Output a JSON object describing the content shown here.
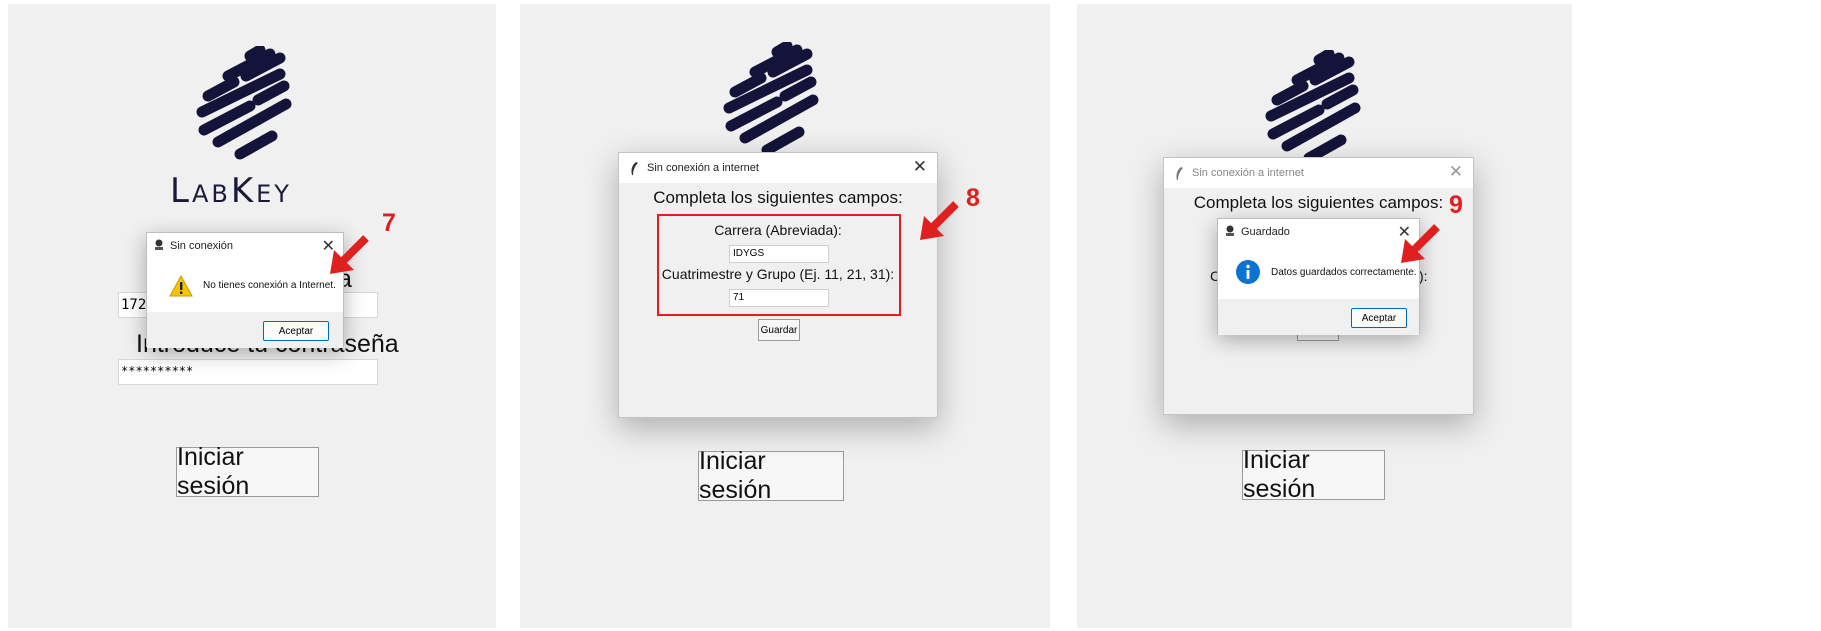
{
  "panel1": {
    "logo_text": "LabKey",
    "ip_value": "172",
    "label_tail": "a",
    "password_label": "Introduce tu contraseña",
    "password_value": "**********",
    "login_button": "Iniciar sesión",
    "dialog": {
      "title": "Sin conexión",
      "message": "No tienes conexión a Internet.",
      "ok_button": "Aceptar"
    },
    "step": "7"
  },
  "panel2": {
    "login_button": "Iniciar sesión",
    "dialog": {
      "title": "Sin conexión a internet",
      "heading": "Completa los siguientes campos:",
      "carrera_label": "Carrera (Abreviada):",
      "carrera_value": "IDYGS",
      "cuatri_label": "Cuatrimestre y Grupo (Ej. 11, 21, 31):",
      "cuatri_value": "71",
      "save_button": "Guardar"
    },
    "step": "8"
  },
  "panel3": {
    "login_button": "Iniciar sesión",
    "dialog": {
      "title": "Sin conexión a internet",
      "heading": "Completa los siguientes campos:",
      "left_fragment": "C",
      "right_fragment": "):"
    },
    "msgbox": {
      "title": "Guardado",
      "message": "Datos guardados correctamente.",
      "ok_button": "Aceptar"
    },
    "step": "9"
  },
  "colors": {
    "accent_red": "#e0201e",
    "logo_navy": "#14143a",
    "info_blue": "#0a74d0",
    "warning_yellow": "#f7c600"
  }
}
